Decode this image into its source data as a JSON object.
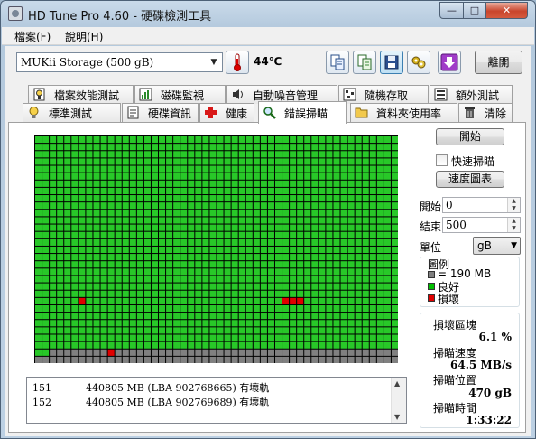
{
  "window": {
    "title": "HD Tune Pro 4.60 - 硬碟檢測工具",
    "min_glyph": "—",
    "max_glyph": "□",
    "close_glyph": "✕"
  },
  "menu": [
    {
      "label": "檔案(F)"
    },
    {
      "label": "說明(H)"
    }
  ],
  "toolbar": {
    "drive": "MUKii  Storage        (500 gB)",
    "temperature": "44℃",
    "exit_label": "離開"
  },
  "tabs_row1": [
    {
      "label": "檔案效能測試"
    },
    {
      "label": "磁碟監視"
    },
    {
      "label": "自動噪音管理"
    },
    {
      "label": "隨機存取"
    },
    {
      "label": "額外測試"
    }
  ],
  "tabs_row2": [
    {
      "label": "標準測試"
    },
    {
      "label": "硬碟資訊"
    },
    {
      "label": "健康"
    },
    {
      "label": "錯誤掃瞄"
    },
    {
      "label": "資料夾使用率"
    },
    {
      "label": "清除"
    }
  ],
  "error_scan": {
    "start_button": "開始",
    "quick_scan_label": "快速掃瞄",
    "quick_scan_checked": false,
    "speed_map_button": "速度圖表",
    "start_label": "開始",
    "start_value": "0",
    "end_label": "結束",
    "end_value": "500",
    "unit_label": "單位",
    "unit_value": "gB",
    "legend_title": "圖例",
    "legend": [
      {
        "label": "= 190 MB",
        "color": "#808080"
      },
      {
        "label": "良好",
        "color": "#00c000"
      },
      {
        "label": "損壞",
        "color": "#e00000"
      }
    ],
    "damaged_blocks_label": "損壞區塊",
    "damaged_blocks_value": "6.1 %",
    "scan_speed_label": "掃瞄速度",
    "scan_speed_value": "64.5 MB/s",
    "scan_position_label": "掃瞄位置",
    "scan_position_value": "470 gB",
    "scan_time_label": "掃瞄時間",
    "scan_time_value": "1:33:22",
    "grid": {
      "cols": 50,
      "rows": 31,
      "colors": {
        "good": "#28c828",
        "bad": "#e00000",
        "pending": "#808080"
      },
      "scanned_rows_full": 29,
      "scanned_cells_last_row": 2,
      "bad_blocks": [
        {
          "row": 22,
          "col": 6
        },
        {
          "row": 22,
          "col": 34
        },
        {
          "row": 22,
          "col": 35
        },
        {
          "row": 22,
          "col": 36
        },
        {
          "row": 29,
          "col": 10
        }
      ]
    },
    "log": [
      {
        "index": "151",
        "text": "440805 MB (LBA 902768665) 有壞軌"
      },
      {
        "index": "152",
        "text": "440805 MB (LBA 902769689) 有壞軌"
      }
    ]
  }
}
